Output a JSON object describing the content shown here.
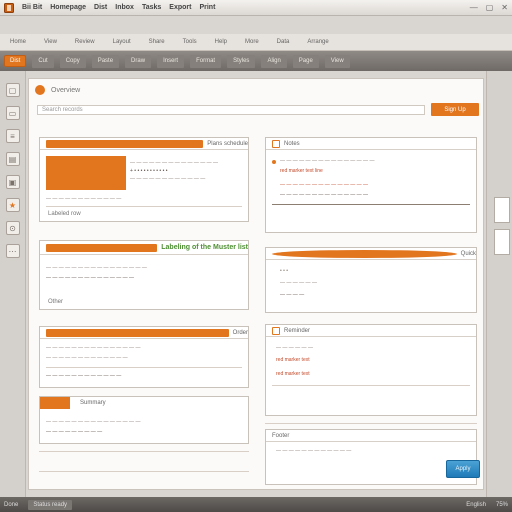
{
  "app": {
    "title": "Bii Bit",
    "tabs": [
      "Homepage",
      "Dist",
      "Inbox",
      "Tasks",
      "Export",
      "Print"
    ]
  },
  "ribbon": {
    "active": "Dist",
    "items": [
      "Home",
      "View",
      "Review",
      "Layout",
      "Share",
      "Tools",
      "Help",
      "More",
      "Data",
      "Arrange"
    ],
    "secondary": [
      "Cut",
      "Copy",
      "Paste",
      "Draw",
      "Insert",
      "Format",
      "Styles",
      "Align",
      "Page",
      "View"
    ]
  },
  "canvas": {
    "title": "Overview",
    "search_placeholder": "Search records",
    "button_label": "Sign Up"
  },
  "cards": [
    {
      "id": "c1",
      "title": "Plans schedule",
      "lines": [
        "— — — — — — — — — — — — — —",
        "+  • • • • • • • • • • •",
        "— — — — — — — — — — — —",
        "— — — — — — — — — — — —"
      ],
      "tag": "Labeled row"
    },
    {
      "id": "c2",
      "title": "Notes",
      "lines": [
        "— — — — — — — — — — — — — — —",
        "red marker text line",
        "— — — — — — — — — — — — — —",
        "— — — — — — — — — — — — — —"
      ]
    },
    {
      "id": "c3",
      "title": "Labeling of the Muster list",
      "lines": [
        "— — — — — — — — — — — — — — — —",
        "— — — — — — — — — — — — — —"
      ],
      "tag": "Other"
    },
    {
      "id": "c4",
      "title": "Quick",
      "lines": [
        "• • •",
        "— — — — — —",
        "— — — —"
      ]
    },
    {
      "id": "c5",
      "title": "Order",
      "lines": [
        "— — — — — — — — — — — — — — —",
        "— — — — — — — — — — — — —",
        "— — — — — — — — — — — —"
      ]
    },
    {
      "id": "c6",
      "title": "Reminder",
      "lines": [
        "— — — — — —",
        "red marker text",
        "red marker text"
      ]
    },
    {
      "id": "c7",
      "title": "Summary",
      "lines": [
        "— — — — — — — — — — — — — — —",
        "— — — — — — — — —"
      ]
    },
    {
      "id": "c8",
      "title": "Footer",
      "lines": [
        "— — — — — — — — — — — —"
      ]
    }
  ],
  "cta": {
    "label": "Apply"
  },
  "status": {
    "left": "Done",
    "chip": "Status ready",
    "right": [
      "English",
      "75%"
    ]
  },
  "colors": {
    "accent": "#e2761f",
    "accent_soft": "#ea8c3d",
    "link": "#1f7ab7",
    "positive": "#4e8f33"
  }
}
